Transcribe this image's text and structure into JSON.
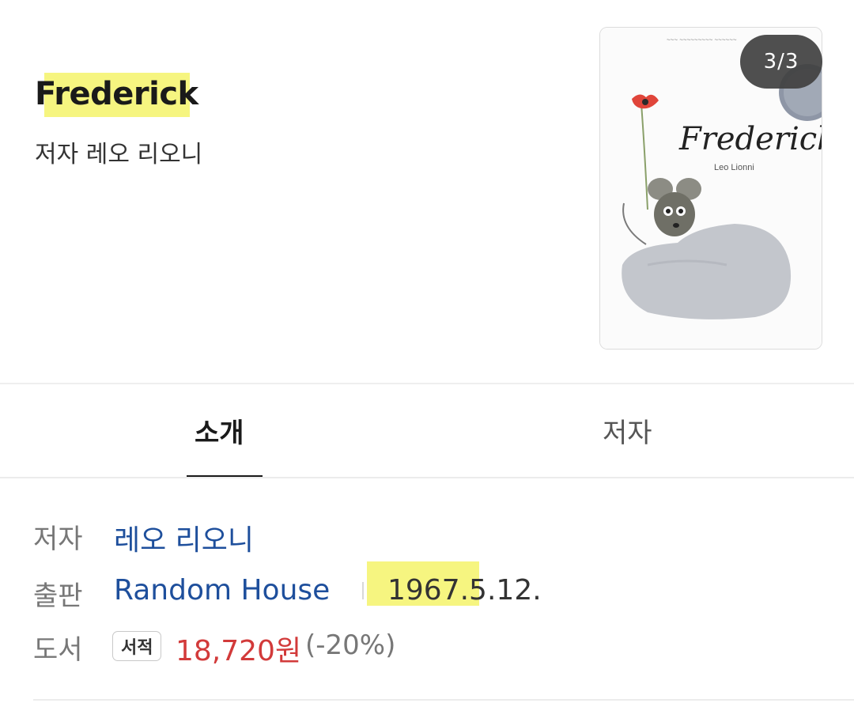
{
  "header": {
    "title": "Frederick",
    "subtitle": "저자  레오 리오니"
  },
  "cover": {
    "counter": "3/3",
    "book_title": "Frederick",
    "book_author": "Leo Lionni"
  },
  "tabs": [
    {
      "label": "소개",
      "active": true
    },
    {
      "label": "저자",
      "active": false
    }
  ],
  "info": {
    "author_label": "저자",
    "author_value": "레오 리오니",
    "publisher_label": "출판",
    "publisher_value": "Random House",
    "date": "1967.5.12.",
    "book_label": "도서",
    "badge": "서적",
    "price": "18,720원",
    "discount": "(-20%)"
  },
  "colors": {
    "highlight": "#f5f36a",
    "link": "#1e4f9c",
    "price": "#d23a3a"
  }
}
